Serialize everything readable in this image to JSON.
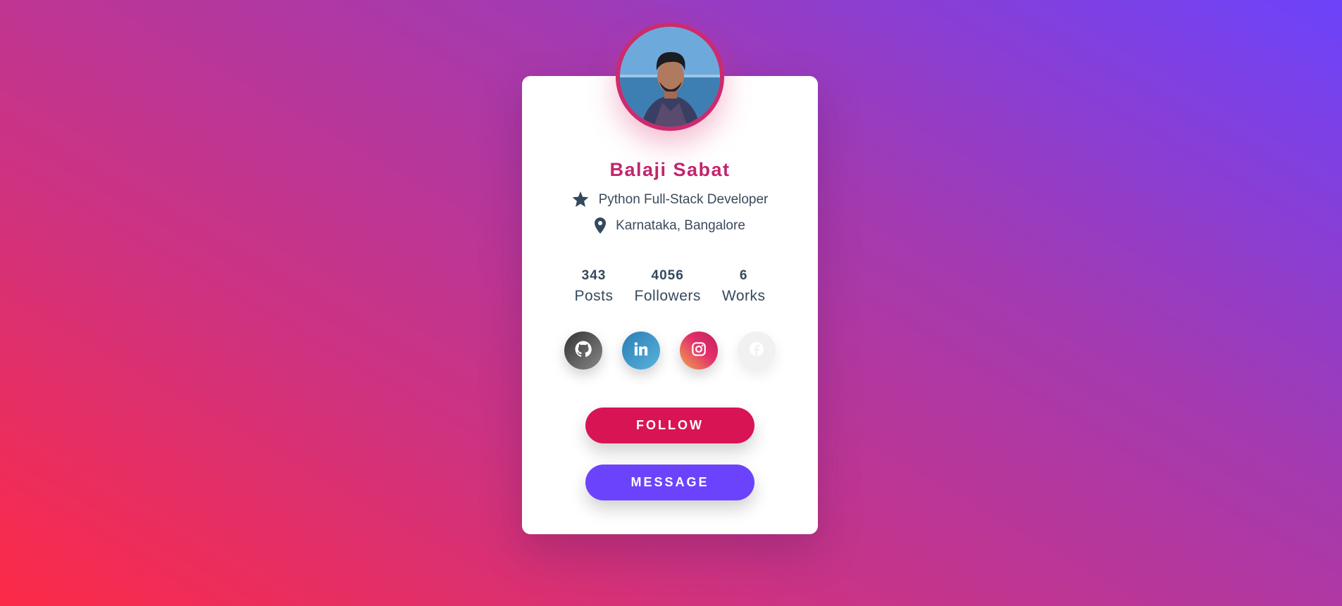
{
  "profile": {
    "name": "Balaji Sabat",
    "role": "Python Full-Stack Developer",
    "location": "Karnataka, Bangalore"
  },
  "stats": [
    {
      "value": "343",
      "label": "Posts"
    },
    {
      "value": "4056",
      "label": "Followers"
    },
    {
      "value": "6",
      "label": "Works"
    }
  ],
  "socials": [
    {
      "icon": "github-icon"
    },
    {
      "icon": "linkedin-icon"
    },
    {
      "icon": "instagram-icon"
    },
    {
      "icon": "facebook-icon"
    }
  ],
  "buttons": {
    "follow": "FOLLOW",
    "message": "MESSAGE"
  },
  "colors": {
    "name": "#c2256d",
    "follow": "#d81455",
    "message": "#6b43fc",
    "text": "#3a4a5c"
  }
}
